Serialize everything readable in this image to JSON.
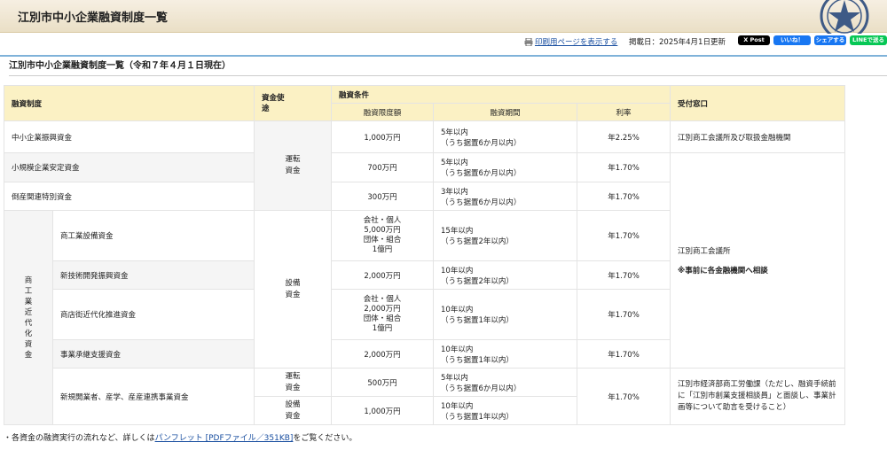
{
  "page": {
    "title": "江別市中小企業融資制度一覧"
  },
  "actions": {
    "print_label": "印刷用ページを表示する",
    "posted": "掲載日：2025年4月1日更新",
    "x_post": "X Post",
    "fb_like": "いいね！",
    "fb_share": "シェアする",
    "line": "LINEで送る"
  },
  "section": {
    "title": "江別市中小企業融資制度一覧（令和７年４月１日現在）"
  },
  "table": {
    "headers": {
      "system": "融資制度",
      "purpose": "資金使途",
      "conditions": "融資条件",
      "limit": "融資限度額",
      "period": "融資期間",
      "rate": "利率",
      "window": "受付窓口"
    },
    "group_label": "商工業近代化資金",
    "purpose_operating": "運転資金",
    "purpose_equipment": "設備資金",
    "window_1": "江別商工会議所及び取扱金融機関",
    "window_2_a": "江別商工会議所",
    "window_2_b": "※事前に各金融機関へ相談",
    "window_3": "江別市経済部商工労働課（ただし、融資手続前に「江別市創業支援相談員」と面談し、事業計画等について助言を受けること）",
    "rows": [
      {
        "name": "中小企業振興資金",
        "limit": "1,000万円",
        "period_1": "5年以内",
        "period_2": "（うち据置6か月以内）",
        "rate": "年2.25%"
      },
      {
        "name": "小規模企業安定資金",
        "limit": "700万円",
        "period_1": "5年以内",
        "period_2": "（うち据置6か月以内）",
        "rate": "年1.70%"
      },
      {
        "name": "倒産関連特別資金",
        "limit": "300万円",
        "period_1": "3年以内",
        "period_2": "（うち据置6か月以内）",
        "rate": "年1.70%"
      },
      {
        "name": "商工業設備資金",
        "limit_1": "会社・個人",
        "limit_2": "5,000万円",
        "limit_3": "団体・組合",
        "limit_4": "1億円",
        "period_1": "15年以内",
        "period_2": "（うち据置2年以内）",
        "rate": "年1.70%"
      },
      {
        "name": "新技術開発振興資金",
        "limit": "2,000万円",
        "period_1": "10年以内",
        "period_2": "（うち据置2年以内）",
        "rate": "年1.70%"
      },
      {
        "name": "商店街近代化推進資金",
        "limit_1": "会社・個人",
        "limit_2": "2,000万円",
        "limit_3": "団体・組合",
        "limit_4": "1億円",
        "period_1": "10年以内",
        "period_2": "（うち据置1年以内）",
        "rate": "年1.70%"
      },
      {
        "name": "事業承継支援資金",
        "limit": "2,000万円",
        "period_1": "10年以内",
        "period_2": "（うち据置1年以内）",
        "rate": "年1.70%"
      },
      {
        "name": "新規開業者、産学、産産連携事業資金",
        "limit_a": "500万円",
        "period_a_1": "5年以内",
        "period_a_2": "（うち据置6か月以内）",
        "limit_b": "1,000万円",
        "period_b_1": "10年以内",
        "period_b_2": "（うち据置1年以内）",
        "rate": "年1.70%"
      }
    ]
  },
  "footnote": {
    "prefix": "・各資金の融資実行の流れなど、詳しくは",
    "link": "パンフレット [PDFファイル／351KB]",
    "suffix": "をご覧ください。"
  }
}
